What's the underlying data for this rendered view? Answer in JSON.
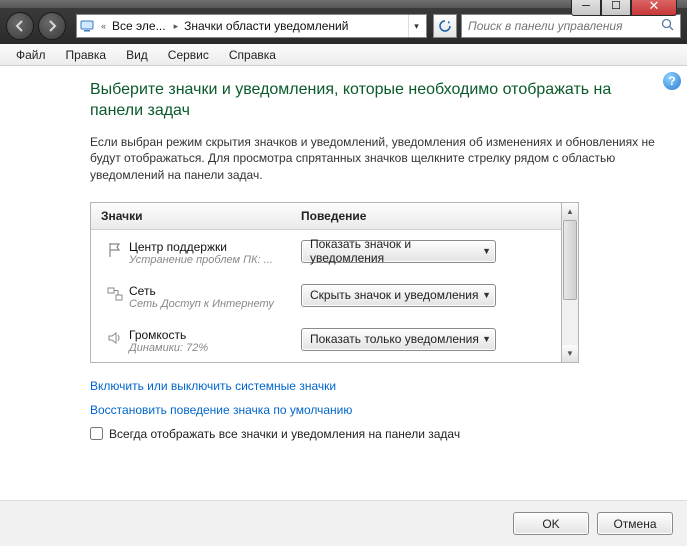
{
  "breadcrumb": {
    "seg1": "Все эле...",
    "seg2": "Значки области уведомлений"
  },
  "search": {
    "placeholder": "Поиск в панели управления"
  },
  "menu": {
    "file": "Файл",
    "edit": "Правка",
    "view": "Вид",
    "service": "Сервис",
    "help": "Справка"
  },
  "heading": "Выберите значки и уведомления, которые необходимо отображать на панели задач",
  "desc": "Если выбран режим скрытия значков и уведомлений, уведомления об изменениях и обновлениях не будут отображаться. Для просмотра спрятанных значков щелкните стрелку рядом с областью уведомлений на панели задач.",
  "col1": "Значки",
  "col2": "Поведение",
  "items": [
    {
      "title": "Центр поддержки",
      "sub": "Устранение проблем ПК: ...",
      "value": "Показать значок и уведомления"
    },
    {
      "title": "Сеть",
      "sub": "Сеть Доступ к Интернету",
      "value": "Скрыть значок и уведомления"
    },
    {
      "title": "Громкость",
      "sub": "Динамики: 72%",
      "value": "Показать только уведомления"
    }
  ],
  "link1": "Включить или выключить системные значки",
  "link2": "Восстановить поведение значка по умолчанию",
  "checkbox_label": "Всегда отображать все значки и уведомления на панели задач",
  "ok": "OK",
  "cancel": "Отмена"
}
